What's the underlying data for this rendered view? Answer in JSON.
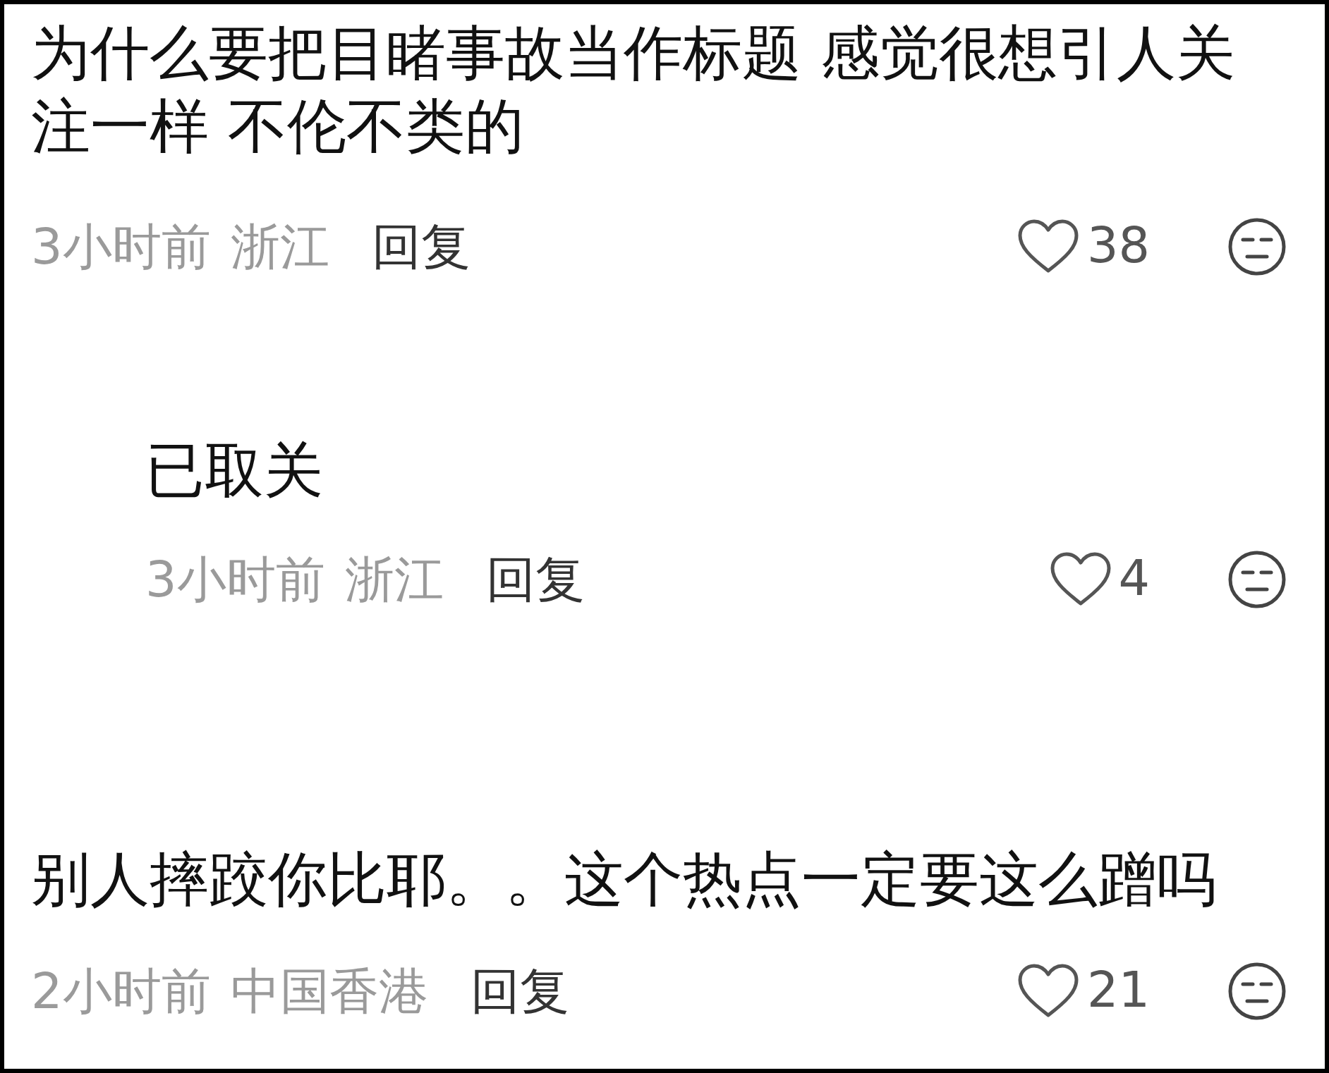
{
  "comments": [
    {
      "kind": "comment",
      "text": "为什么要把目睹事故当作标题 感觉很想引人关注一样 不伦不类的",
      "time": "3小时前",
      "location": "浙江",
      "reply_label": "回复",
      "likes": "38"
    },
    {
      "kind": "reply",
      "text": "已取关",
      "time": "3小时前",
      "location": "浙江",
      "reply_label": "回复",
      "likes": "4"
    },
    {
      "kind": "comment",
      "text": "别人摔跤你比耶。。这个热点一定要这么蹭吗",
      "time": "2小时前",
      "location": "中国香港",
      "reply_label": "回复",
      "likes": "21"
    }
  ]
}
